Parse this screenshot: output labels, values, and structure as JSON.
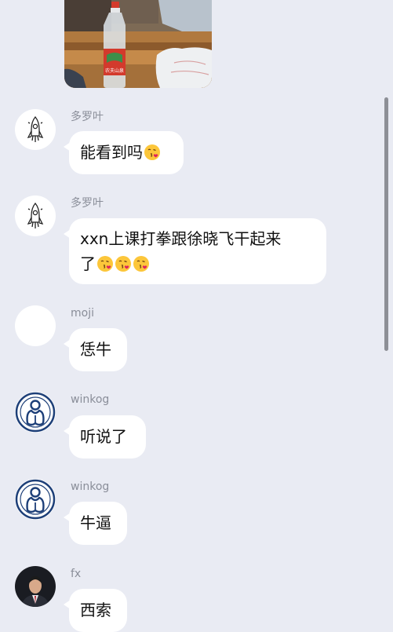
{
  "photo": {
    "bottle_label": "农夫山泉"
  },
  "messages": [
    {
      "sender": "多罗叶",
      "text": "能看到吗",
      "emoji_count": 1,
      "emoji": "kissing-face-emoji",
      "avatar": "rocket-avatar-icon"
    },
    {
      "sender": "多罗叶",
      "line1": "xxn上课打拳跟徐晓飞干起来",
      "line2": "了",
      "emoji_count": 3,
      "emoji": "kissing-face-emoji",
      "avatar": "rocket-avatar-icon"
    },
    {
      "sender": "moji",
      "text": "恁牛",
      "avatar": "blank-avatar"
    },
    {
      "sender": "winkog",
      "text": "听说了",
      "avatar": "team-logo-avatar-icon"
    },
    {
      "sender": "winkog",
      "text": "牛逼",
      "avatar": "team-logo-avatar-icon"
    },
    {
      "sender": "fx",
      "text": "西索",
      "avatar": "person-photo-avatar"
    }
  ],
  "colors": {
    "background": "#e9ebf3",
    "bubble": "#ffffff",
    "name_text": "#8a8e99",
    "message_text": "#111111",
    "scrollbar": "#8d8f96"
  }
}
